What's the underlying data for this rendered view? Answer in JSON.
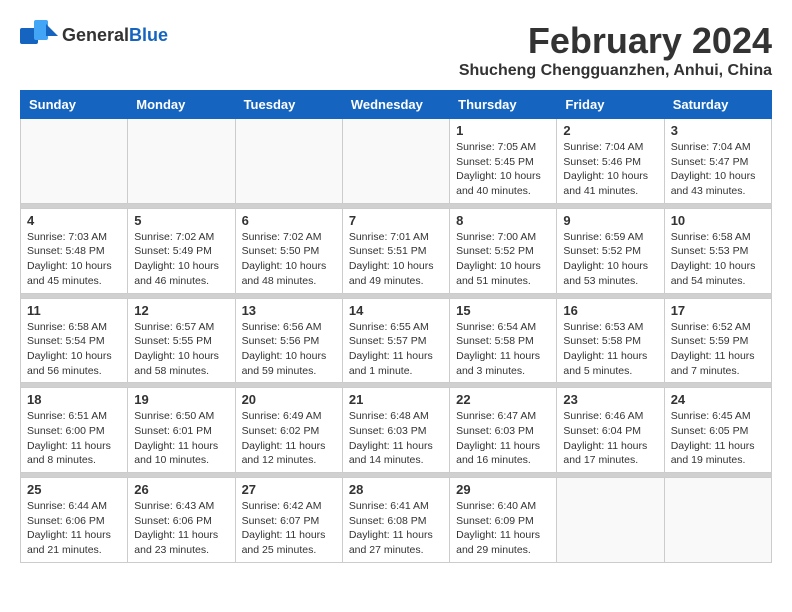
{
  "header": {
    "logo_line1": "General",
    "logo_line2": "Blue",
    "month_title": "February 2024",
    "subtitle": "Shucheng Chengguanzhen, Anhui, China"
  },
  "days_of_week": [
    "Sunday",
    "Monday",
    "Tuesday",
    "Wednesday",
    "Thursday",
    "Friday",
    "Saturday"
  ],
  "weeks": [
    [
      {
        "day": "",
        "info": ""
      },
      {
        "day": "",
        "info": ""
      },
      {
        "day": "",
        "info": ""
      },
      {
        "day": "",
        "info": ""
      },
      {
        "day": "1",
        "info": "Sunrise: 7:05 AM\nSunset: 5:45 PM\nDaylight: 10 hours\nand 40 minutes."
      },
      {
        "day": "2",
        "info": "Sunrise: 7:04 AM\nSunset: 5:46 PM\nDaylight: 10 hours\nand 41 minutes."
      },
      {
        "day": "3",
        "info": "Sunrise: 7:04 AM\nSunset: 5:47 PM\nDaylight: 10 hours\nand 43 minutes."
      }
    ],
    [
      {
        "day": "4",
        "info": "Sunrise: 7:03 AM\nSunset: 5:48 PM\nDaylight: 10 hours\nand 45 minutes."
      },
      {
        "day": "5",
        "info": "Sunrise: 7:02 AM\nSunset: 5:49 PM\nDaylight: 10 hours\nand 46 minutes."
      },
      {
        "day": "6",
        "info": "Sunrise: 7:02 AM\nSunset: 5:50 PM\nDaylight: 10 hours\nand 48 minutes."
      },
      {
        "day": "7",
        "info": "Sunrise: 7:01 AM\nSunset: 5:51 PM\nDaylight: 10 hours\nand 49 minutes."
      },
      {
        "day": "8",
        "info": "Sunrise: 7:00 AM\nSunset: 5:52 PM\nDaylight: 10 hours\nand 51 minutes."
      },
      {
        "day": "9",
        "info": "Sunrise: 6:59 AM\nSunset: 5:52 PM\nDaylight: 10 hours\nand 53 minutes."
      },
      {
        "day": "10",
        "info": "Sunrise: 6:58 AM\nSunset: 5:53 PM\nDaylight: 10 hours\nand 54 minutes."
      }
    ],
    [
      {
        "day": "11",
        "info": "Sunrise: 6:58 AM\nSunset: 5:54 PM\nDaylight: 10 hours\nand 56 minutes."
      },
      {
        "day": "12",
        "info": "Sunrise: 6:57 AM\nSunset: 5:55 PM\nDaylight: 10 hours\nand 58 minutes."
      },
      {
        "day": "13",
        "info": "Sunrise: 6:56 AM\nSunset: 5:56 PM\nDaylight: 10 hours\nand 59 minutes."
      },
      {
        "day": "14",
        "info": "Sunrise: 6:55 AM\nSunset: 5:57 PM\nDaylight: 11 hours\nand 1 minute."
      },
      {
        "day": "15",
        "info": "Sunrise: 6:54 AM\nSunset: 5:58 PM\nDaylight: 11 hours\nand 3 minutes."
      },
      {
        "day": "16",
        "info": "Sunrise: 6:53 AM\nSunset: 5:58 PM\nDaylight: 11 hours\nand 5 minutes."
      },
      {
        "day": "17",
        "info": "Sunrise: 6:52 AM\nSunset: 5:59 PM\nDaylight: 11 hours\nand 7 minutes."
      }
    ],
    [
      {
        "day": "18",
        "info": "Sunrise: 6:51 AM\nSunset: 6:00 PM\nDaylight: 11 hours\nand 8 minutes."
      },
      {
        "day": "19",
        "info": "Sunrise: 6:50 AM\nSunset: 6:01 PM\nDaylight: 11 hours\nand 10 minutes."
      },
      {
        "day": "20",
        "info": "Sunrise: 6:49 AM\nSunset: 6:02 PM\nDaylight: 11 hours\nand 12 minutes."
      },
      {
        "day": "21",
        "info": "Sunrise: 6:48 AM\nSunset: 6:03 PM\nDaylight: 11 hours\nand 14 minutes."
      },
      {
        "day": "22",
        "info": "Sunrise: 6:47 AM\nSunset: 6:03 PM\nDaylight: 11 hours\nand 16 minutes."
      },
      {
        "day": "23",
        "info": "Sunrise: 6:46 AM\nSunset: 6:04 PM\nDaylight: 11 hours\nand 17 minutes."
      },
      {
        "day": "24",
        "info": "Sunrise: 6:45 AM\nSunset: 6:05 PM\nDaylight: 11 hours\nand 19 minutes."
      }
    ],
    [
      {
        "day": "25",
        "info": "Sunrise: 6:44 AM\nSunset: 6:06 PM\nDaylight: 11 hours\nand 21 minutes."
      },
      {
        "day": "26",
        "info": "Sunrise: 6:43 AM\nSunset: 6:06 PM\nDaylight: 11 hours\nand 23 minutes."
      },
      {
        "day": "27",
        "info": "Sunrise: 6:42 AM\nSunset: 6:07 PM\nDaylight: 11 hours\nand 25 minutes."
      },
      {
        "day": "28",
        "info": "Sunrise: 6:41 AM\nSunset: 6:08 PM\nDaylight: 11 hours\nand 27 minutes."
      },
      {
        "day": "29",
        "info": "Sunrise: 6:40 AM\nSunset: 6:09 PM\nDaylight: 11 hours\nand 29 minutes."
      },
      {
        "day": "",
        "info": ""
      },
      {
        "day": "",
        "info": ""
      }
    ]
  ]
}
